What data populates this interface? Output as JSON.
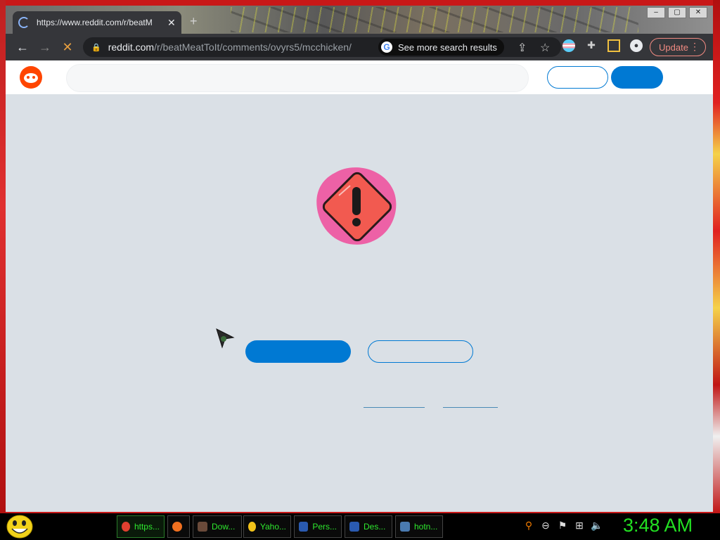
{
  "browser": {
    "tab": {
      "title": "https://www.reddit.com/r/beatM",
      "close": "✕"
    },
    "new_tab": "+",
    "window_controls": [
      "–",
      "▢",
      "✕"
    ],
    "nav": {
      "back": "←",
      "forward": "→",
      "stop": "✕"
    },
    "address": {
      "host": "reddit.com",
      "path": "/r/beatMeatToIt/comments/ovyrs5/mcchicken/"
    },
    "search_chip": {
      "icon": "G",
      "label": "See more search results"
    },
    "update_label": "Update",
    "menu": "⋮"
  },
  "taskbar": {
    "items": [
      {
        "label": "https...",
        "icon": "chrome-icon"
      },
      {
        "label": "",
        "icon": "firefox-icon"
      },
      {
        "label": "Dow...",
        "icon": "downloads-icon"
      },
      {
        "label": "Yaho...",
        "icon": "yahoo-icon"
      },
      {
        "label": "Pers...",
        "icon": "monitor-icon"
      },
      {
        "label": "Des...",
        "icon": "monitor-icon"
      },
      {
        "label": "hotn...",
        "icon": "window-icon"
      }
    ],
    "clock": "3:48 AM"
  }
}
